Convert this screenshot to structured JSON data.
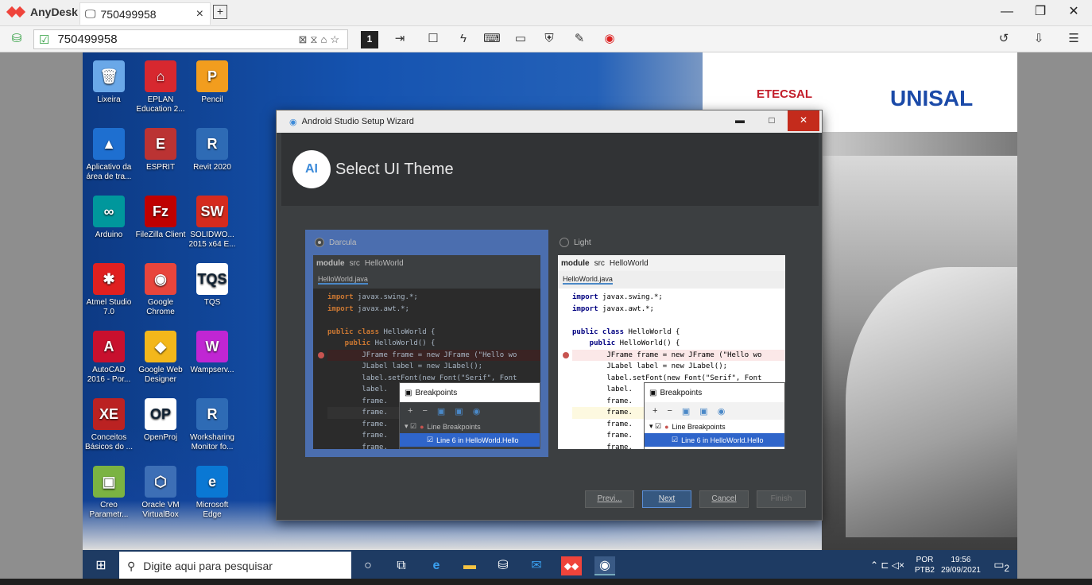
{
  "anydesk": {
    "brand": "AnyDesk",
    "tab_label": "750499958",
    "tab_close": "×",
    "new_tab": "+",
    "address_value": "750499958",
    "window_buttons": [
      "—",
      "❐",
      "✕"
    ]
  },
  "desktop": {
    "icons": [
      {
        "label": "Lixeira",
        "glyph": "🗑",
        "color": "#6aa8e8"
      },
      {
        "label": "EPLAN Education 2...",
        "glyph": "⌂",
        "color": "#d7282f"
      },
      {
        "label": "Pencil",
        "glyph": "P",
        "color": "#f29d1e"
      },
      {
        "label": "Aplicativo da área de tra...",
        "glyph": "▲",
        "color": "#1e6fd0"
      },
      {
        "label": "ESPRIT",
        "glyph": "E",
        "color": "#b33"
      },
      {
        "label": "Revit 2020",
        "glyph": "R",
        "color": "#2e6bb5"
      },
      {
        "label": "Arduino",
        "glyph": "∞",
        "color": "#00979c"
      },
      {
        "label": "FileZilla Client",
        "glyph": "Fz",
        "color": "#bf0000"
      },
      {
        "label": "SOLIDWO... 2015 x64 E...",
        "glyph": "SW",
        "color": "#d52b1e"
      },
      {
        "label": "Atmel Studio 7.0",
        "glyph": "✱",
        "color": "#e02020"
      },
      {
        "label": "Google Chrome",
        "glyph": "◉",
        "color": "#e8453c"
      },
      {
        "label": "TQS",
        "glyph": "TQS",
        "color": "#ffffff"
      },
      {
        "label": "AutoCAD 2016 - Por...",
        "glyph": "A",
        "color": "#c8102e"
      },
      {
        "label": "Google Web Designer",
        "glyph": "◆",
        "color": "#f3b71b"
      },
      {
        "label": "Wampserv...",
        "glyph": "W",
        "color": "#c026d3"
      },
      {
        "label": "Conceitos Básicos do ...",
        "glyph": "XE",
        "color": "#b22"
      },
      {
        "label": "OpenProj",
        "glyph": "OP",
        "color": "#ffffff"
      },
      {
        "label": "Worksharing Monitor fo...",
        "glyph": "R",
        "color": "#2e6bb5"
      },
      {
        "label": "Creo Parametr...",
        "glyph": "▣",
        "color": "#7bb342"
      },
      {
        "label": "Oracle VM VirtualBox",
        "glyph": "⬡",
        "color": "#3d6fb6"
      },
      {
        "label": "Microsoft Edge",
        "glyph": "e",
        "color": "#0a78d4"
      }
    ],
    "logos": {
      "left": "ETECSAL",
      "right": "UNISAL"
    }
  },
  "wizard": {
    "title": "Android Studio Setup Wizard",
    "controls": [
      "▬",
      "□",
      "✕"
    ],
    "heading": "Select UI Theme",
    "themes": [
      {
        "label": "Darcula",
        "selected": true
      },
      {
        "label": "Light",
        "selected": false
      }
    ],
    "preview": {
      "crumbs": [
        "module",
        "src",
        "HelloWorld"
      ],
      "file_tab": "HelloWorld.java",
      "code": [
        {
          "kw": "import",
          "rest": " javax.swing.*;"
        },
        {
          "kw": "import",
          "rest": " javax.awt.*;"
        },
        {
          "kw": "",
          "rest": ""
        },
        {
          "kw": "public class",
          "rest": " HelloWorld {"
        },
        {
          "kw": "    public",
          "rest": " HelloWorld() {"
        },
        {
          "kw": "",
          "rest": "        JFrame frame = new JFrame (\"Hello wo"
        },
        {
          "kw": "",
          "rest": "        JLabel label = new JLabel();"
        },
        {
          "kw": "",
          "rest": "        label.setFont(new Font(\"Serif\", Font"
        },
        {
          "kw": "",
          "rest": "        label."
        },
        {
          "kw": "",
          "rest": "        frame."
        },
        {
          "kw": "",
          "rest": "        frame."
        },
        {
          "kw": "",
          "rest": "        frame."
        },
        {
          "kw": "",
          "rest": "        frame."
        },
        {
          "kw": "",
          "rest": "        frame."
        }
      ],
      "popup_title": "Breakpoints",
      "popup_tools": [
        "+",
        "−",
        "▣",
        "▣",
        "◉"
      ],
      "popup_row1": "Line Breakpoints",
      "popup_row2": "Line 6 in HelloWorld.Hello"
    },
    "buttons": [
      "Previ...",
      "Next",
      "Cancel",
      "Finish"
    ]
  },
  "taskbar": {
    "search_placeholder": "Digite aqui para pesquisar",
    "lang_top": "POR",
    "lang_bottom": "PTB2",
    "time": "19:56",
    "date": "29/09/2021",
    "notif_count": "2"
  }
}
